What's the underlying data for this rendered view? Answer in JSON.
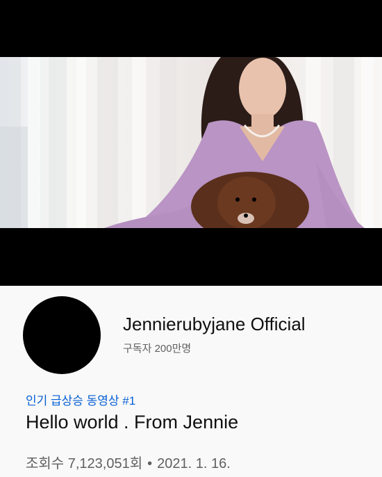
{
  "video": {
    "thumbnail_alt": "Woman in a lilac cardigan with a brown Pomeranian"
  },
  "channel": {
    "name": "Jennierubyjane Official",
    "subscribers": "구독자 200만명"
  },
  "trending_badge": "인기 급상승 동영상 #1",
  "title": "Hello world . From Jennie",
  "meta": {
    "views": "조회수 7,123,051회",
    "separator": "•",
    "date": "2021. 1. 16."
  },
  "colors": {
    "trending": "#065fd4",
    "primary_text": "#0f0f0f",
    "secondary_text": "#606060",
    "background": "#f9f9f9"
  }
}
